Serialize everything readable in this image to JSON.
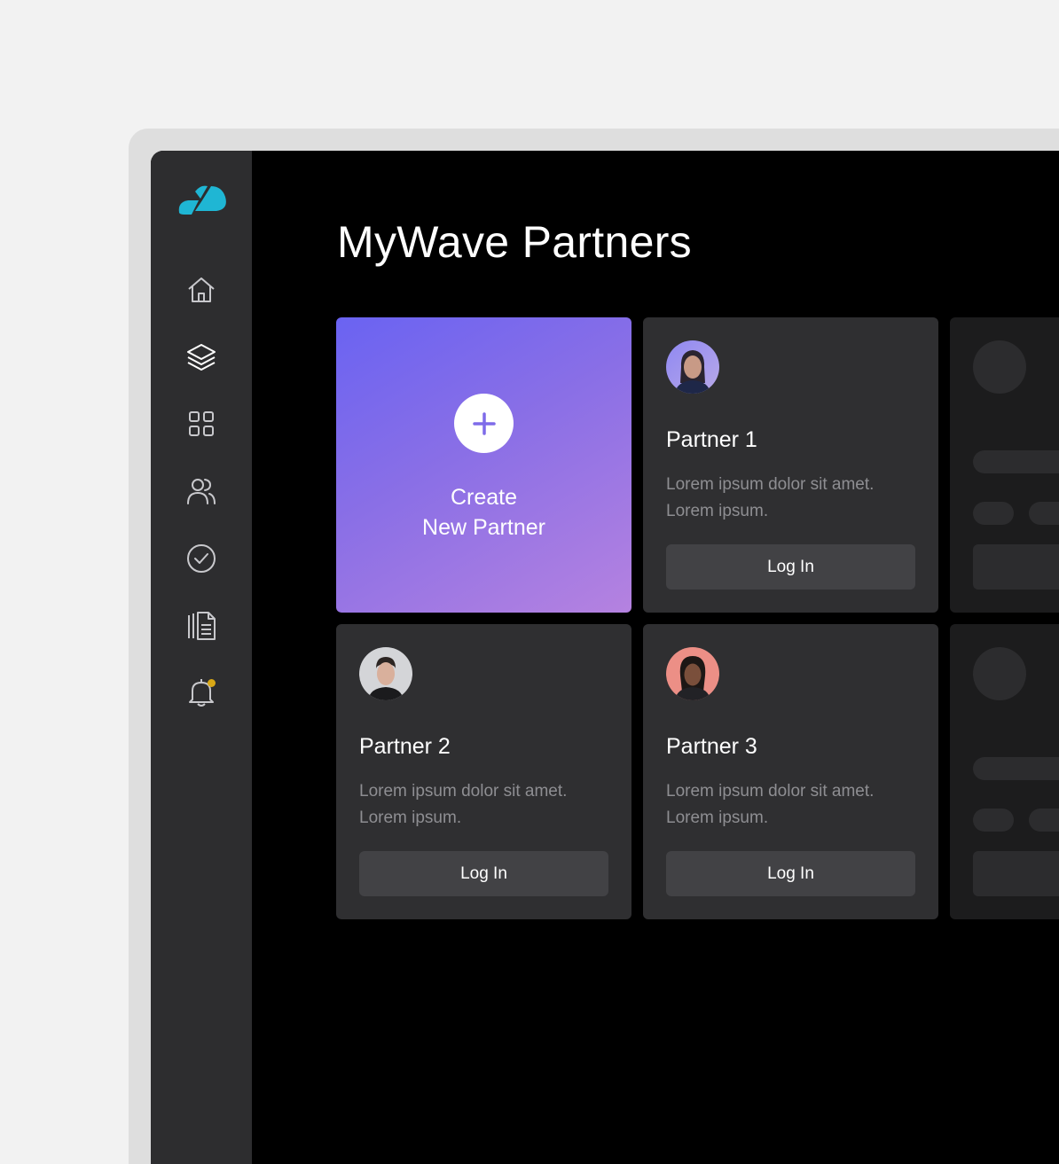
{
  "app": {
    "title": "MyWave Partners",
    "accent_color": "#1fb6d4"
  },
  "sidebar": {
    "logo": "mywave-logo",
    "items": [
      {
        "icon": "home-icon"
      },
      {
        "icon": "layers-icon"
      },
      {
        "icon": "grid-icon"
      },
      {
        "icon": "users-icon"
      },
      {
        "icon": "check-circle-icon"
      },
      {
        "icon": "documents-icon"
      },
      {
        "icon": "bell-icon",
        "has_notification": true,
        "notification_color": "#d8a716"
      }
    ]
  },
  "create_card": {
    "line1": "Create",
    "line2": "New Partner",
    "icon": "plus-icon"
  },
  "partners": [
    {
      "name": "Partner 1",
      "desc1": "Lorem ipsum dolor sit amet.",
      "desc2": "Lorem ipsum.",
      "button": "Log In"
    },
    {
      "name": "Partner 2",
      "desc1": "Lorem ipsum dolor sit amet.",
      "desc2": "Lorem ipsum.",
      "button": "Log In"
    },
    {
      "name": "Partner 3",
      "desc1": "Lorem ipsum dolor sit amet.",
      "desc2": "Lorem ipsum.",
      "button": "Log In"
    }
  ]
}
